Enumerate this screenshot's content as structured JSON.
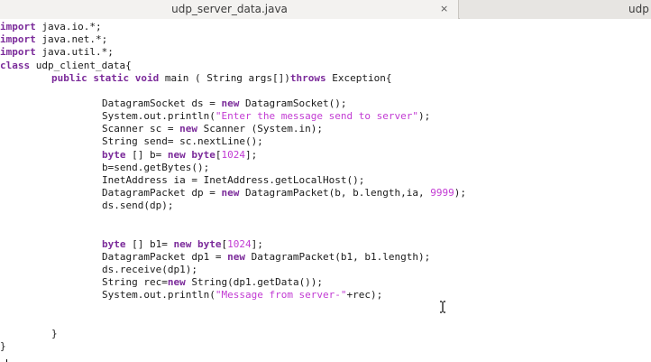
{
  "tabs": [
    {
      "label": "udp_server_data.java",
      "close_icon": "×"
    },
    {
      "label": "udp"
    }
  ],
  "code": {
    "l1_kw": "import",
    "l1_rest": " java.io.*;",
    "l2_kw": "import",
    "l2_rest": " java.net.*;",
    "l3_kw": "import",
    "l3_rest": " java.util.*;",
    "l4_kw": "class",
    "l4_rest": " udp_client_data{",
    "l5_a": "public static void",
    "l5_b": " main ( String args[])",
    "l5_c": "throws",
    "l5_d": " Exception{",
    "l6_a": "DatagramSocket ds = ",
    "l6_b": "new",
    "l6_c": " DatagramSocket();",
    "l7_a": "System.out.println(",
    "l7_b": "\"Enter the message send to server\"",
    "l7_c": ");",
    "l8_a": "Scanner sc = ",
    "l8_b": "new",
    "l8_c": " Scanner (System.in);",
    "l9": "String send= sc.nextLine();",
    "l10_a": "byte",
    "l10_b": " [] b= ",
    "l10_c": "new",
    "l10_d": " ",
    "l10_e": "byte",
    "l10_f": "[",
    "l10_g": "1024",
    "l10_h": "];",
    "l11": "b=send.getBytes();",
    "l12": "InetAddress ia = InetAddress.getLocalHost();",
    "l13_a": "DatagramPacket dp = ",
    "l13_b": "new",
    "l13_c": " DatagramPacket(b, b.length,ia, ",
    "l13_d": "9999",
    "l13_e": ");",
    "l14": "ds.send(dp);",
    "l15_a": "byte",
    "l15_b": " [] b1= ",
    "l15_c": "new",
    "l15_d": " ",
    "l15_e": "byte",
    "l15_f": "[",
    "l15_g": "1024",
    "l15_h": "];",
    "l16_a": "DatagramPacket dp1 = ",
    "l16_b": "new",
    "l16_c": " DatagramPacket(b1, b1.length);",
    "l17": "ds.receive(dp1);",
    "l18_a": "String rec=",
    "l18_b": "new",
    "l18_c": " String(dp1.getData());",
    "l19_a": "System.out.println(",
    "l19_b": "\"Message from server-\"",
    "l19_c": "+rec);",
    "l20": "}",
    "l21": "}"
  },
  "colors": {
    "keyword": "#7b2b9a",
    "string": "#c23bd3",
    "text": "#1a1a1a"
  },
  "icons": {
    "mouse_cursor": "i-beam-icon"
  }
}
